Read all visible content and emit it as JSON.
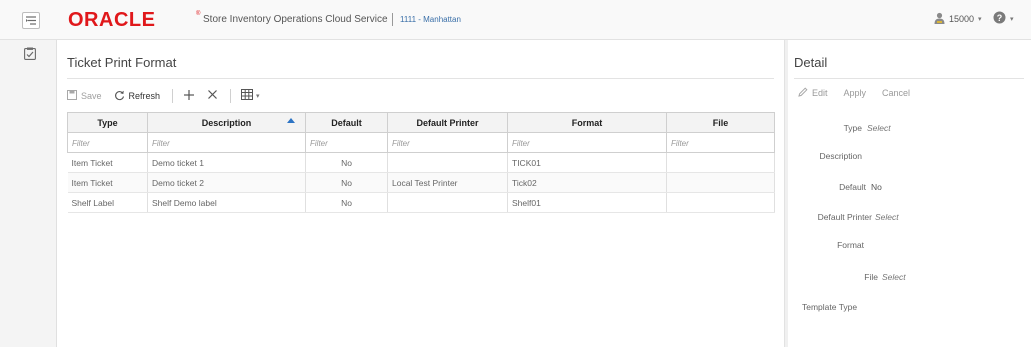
{
  "header": {
    "brand": "ORACLE",
    "brand_mark": "®",
    "app_title": "Store Inventory Operations Cloud Service",
    "store": "1111 - Manhattan",
    "user": "15000",
    "user_caret": "▾",
    "help_caret": "▾"
  },
  "page": {
    "title": "Ticket Print Format",
    "toolbar": {
      "save_label": "Save",
      "refresh_label": "Refresh"
    }
  },
  "grid": {
    "columns": [
      "Type",
      "Description",
      "Default",
      "Default Printer",
      "Format",
      "File"
    ],
    "filter_placeholder": "Filter",
    "rows": [
      [
        "Item Ticket",
        "Demo ticket 1",
        "No",
        "",
        "TICK01",
        ""
      ],
      [
        "Item Ticket",
        "Demo ticket 2",
        "No",
        "Local Test Printer",
        "Tick02",
        ""
      ],
      [
        "Shelf Label",
        "Shelf Demo label",
        "No",
        "",
        "Shelf01",
        ""
      ]
    ]
  },
  "detail": {
    "title": "Detail",
    "toolbar": {
      "edit_label": "Edit",
      "apply_label": "Apply",
      "cancel_label": "Cancel"
    },
    "fields": {
      "type_label": "Type",
      "type_value": "Select",
      "description_label": "Description",
      "default_label": "Default",
      "default_value": "No",
      "default_printer_label": "Default Printer",
      "default_printer_value": "Select",
      "format_label": "Format",
      "file_label": "File",
      "file_value": "Select",
      "template_type_label": "Template Type"
    }
  },
  "colors": {
    "brand_red": "#e0181b",
    "link_blue": "#3a6fa8",
    "sort_blue": "#2d74c4"
  },
  "icons": [
    "menu-icon",
    "user-icon",
    "help-icon",
    "tasks-icon",
    "save-icon",
    "refresh-icon",
    "add-icon",
    "delete-icon",
    "columns-icon",
    "edit-icon",
    "sort-ascending-icon"
  ]
}
